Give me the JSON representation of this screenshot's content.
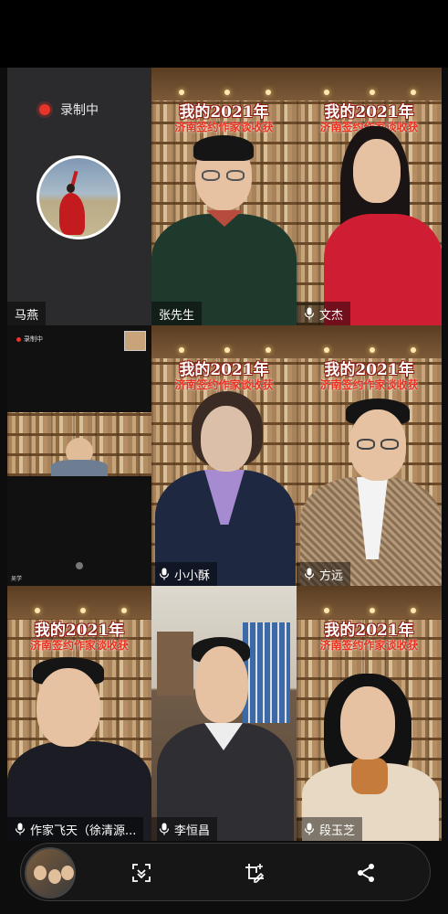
{
  "recording": {
    "status_text": "录制中"
  },
  "tiles": [
    {
      "name": "马燕"
    },
    {
      "name": "张先生",
      "banner_title": "我的2021年",
      "banner_subtitle": "济南签约作家谈收获"
    },
    {
      "name": "文杰",
      "banner_title": "我的2021年",
      "banner_subtitle": "济南签约作家谈收获"
    },
    {
      "name": "",
      "mini_rec": "录制中",
      "mini_label": "吴学"
    },
    {
      "name": "小小酥",
      "banner_title": "我的2021年",
      "banner_subtitle": "济南签约作家谈收获"
    },
    {
      "name": "方远",
      "banner_title": "我的2021年",
      "banner_subtitle": "济南签约作家谈收获"
    },
    {
      "name": "作家飞天（徐清源...",
      "banner_title": "我的2021年",
      "banner_subtitle": "济南签约作家谈收获"
    },
    {
      "name": "李恒昌"
    },
    {
      "name": "段玉芝",
      "banner_title": "我的2021年",
      "banner_subtitle": "济南签约作家谈收获"
    }
  ],
  "toolbar": {
    "icons": [
      "gallery-thumbnail",
      "scroll-capture-icon",
      "edit-screenshot-icon",
      "share-icon"
    ]
  }
}
